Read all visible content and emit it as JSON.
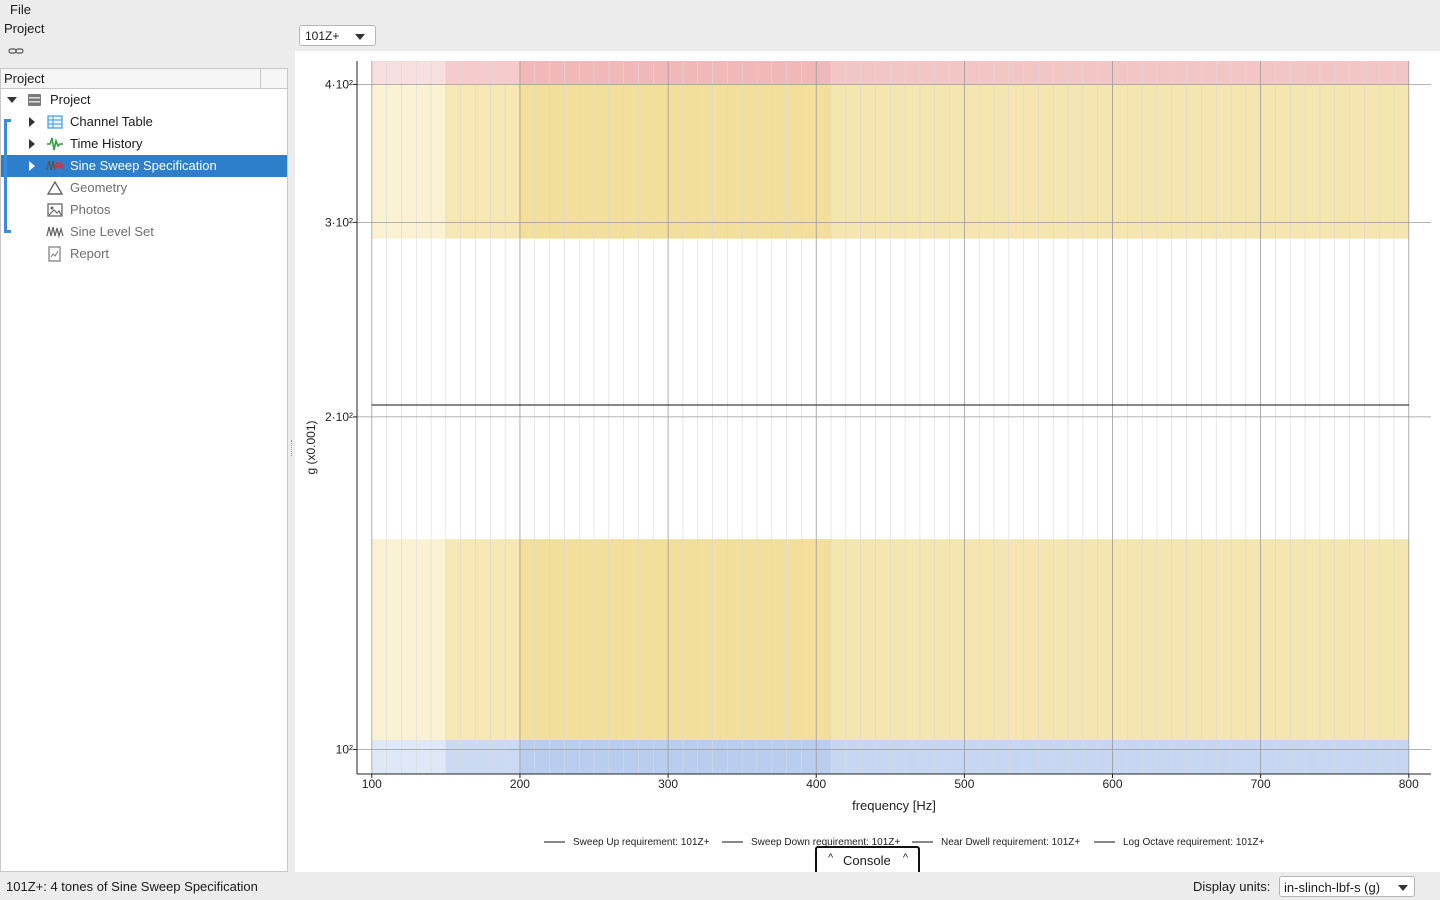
{
  "menubar": {
    "file_label": "File"
  },
  "left_panel": {
    "title": "Project",
    "tree_header": "Project",
    "items": [
      {
        "label": "Project",
        "icon": "project-icon",
        "expanded": true
      },
      {
        "label": "Channel Table",
        "icon": "table-icon"
      },
      {
        "label": "Time History",
        "icon": "waveform-icon"
      },
      {
        "label": "Sine Sweep Specification",
        "icon": "sine-spec-icon",
        "selected": true
      },
      {
        "label": "Geometry",
        "icon": "triangle-icon"
      },
      {
        "label": "Photos",
        "icon": "image-icon"
      },
      {
        "label": "Sine Level Set",
        "icon": "sine-level-icon"
      },
      {
        "label": "Report",
        "icon": "report-icon"
      }
    ]
  },
  "channel_selector": {
    "value": "101Z+"
  },
  "chart_data": {
    "type": "line",
    "xlabel": "frequency [Hz]",
    "ylabel": "g (x0.001)",
    "xlim": [
      90,
      815
    ],
    "ylim_log": [
      95,
      420
    ],
    "x_ticks": [
      100,
      200,
      300,
      400,
      500,
      600,
      700,
      800
    ],
    "x_tick_labels": [
      "100",
      "200",
      "300",
      "400",
      "500",
      "600",
      "700",
      "800"
    ],
    "y_ticks": [
      100,
      200,
      300,
      400
    ],
    "y_tick_labels": [
      "10²",
      "2·10²",
      "3·10²",
      "4·10²"
    ],
    "y_scale": "log",
    "grid": true,
    "series": [
      {
        "name": "Sweep Up requirement: 101Z+",
        "x": [
          100,
          800
        ],
        "y": [
          205,
          205
        ]
      },
      {
        "name": "Sweep Down requirement: 101Z+",
        "x": [
          100,
          800
        ],
        "y": [
          205,
          205
        ]
      },
      {
        "name": "Near Dwell requirement: 101Z+",
        "x": [
          100,
          800
        ],
        "y": [
          205,
          205
        ]
      },
      {
        "name": "Log Octave requirement: 101Z+",
        "x": [
          100,
          800
        ],
        "y": [
          205,
          205
        ]
      }
    ],
    "tolerance_bands": [
      {
        "level": "upper-abort",
        "y_range": [
          400,
          420
        ],
        "color": "#f0b8b8"
      },
      {
        "level": "upper-alarm",
        "y_range": [
          290,
          400
        ],
        "color": "#f3df9c"
      },
      {
        "level": "lower-alarm",
        "y_range": [
          102,
          155
        ],
        "color": "#f3df9c"
      },
      {
        "level": "lower-abort",
        "y_range": [
          95,
          102
        ],
        "color": "#b9cdee"
      }
    ],
    "legend_position": "bottom"
  },
  "console": {
    "label": "Console"
  },
  "statusbar": {
    "text": "101Z+: 4 tones of Sine Sweep Specification",
    "units_label": "Display units:",
    "units_value": "in-slinch-lbf-s (g)"
  },
  "colors": {
    "selection": "#2d7fcc",
    "accent": "#3b8be0"
  }
}
